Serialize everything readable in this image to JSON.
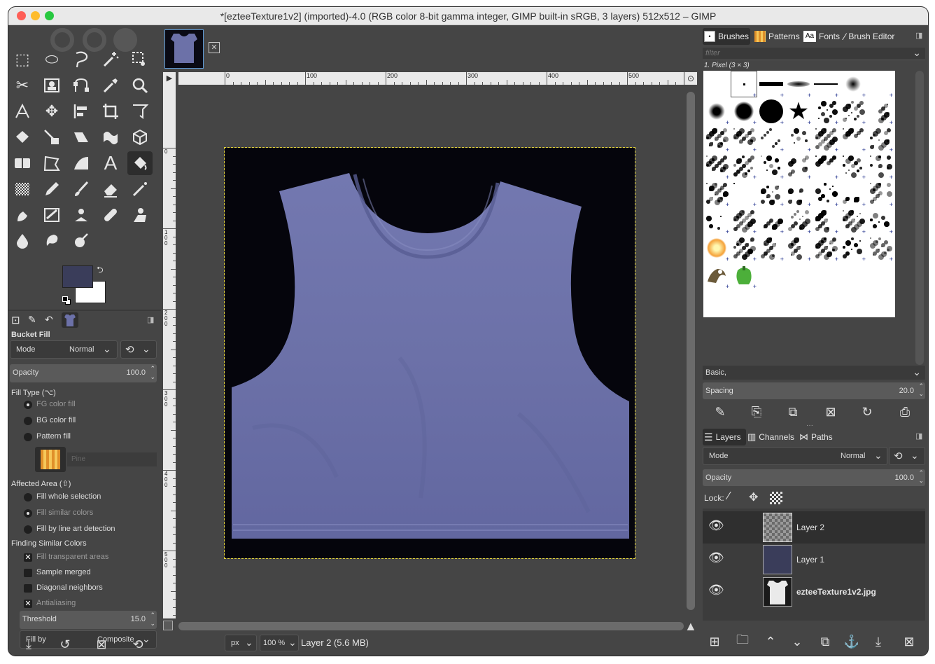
{
  "window": {
    "title": "*[ezteeTexture1v2] (imported)-4.0 (RGB color 8-bit gamma integer, GIMP built-in sRGB, 3 layers) 512x512 – GIMP",
    "traffic_lights": {
      "close": "#fe5f57",
      "minimize": "#febc2e",
      "zoom": "#28c840"
    }
  },
  "colors": {
    "fg_color": "#3a3d5a",
    "bg_color": "#ffffff",
    "accent": "#5f9bd8",
    "shirt": "#6c71a8",
    "canvas_bg": "#05050c"
  },
  "tool_options": {
    "title": "Bucket Fill",
    "mode_label": "Mode",
    "mode_value": "Normal",
    "opacity_label": "Opacity",
    "opacity_value": "100.0",
    "fill_type_label": "Fill Type  (⌥)",
    "fill_types": [
      {
        "label": "FG color fill",
        "selected": true
      },
      {
        "label": "BG color fill",
        "selected": false
      },
      {
        "label": "Pattern fill",
        "selected": false
      }
    ],
    "pattern_name": "Pine",
    "affected_area_label": "Affected Area  (⇧)",
    "affected_areas": [
      {
        "label": "Fill whole selection",
        "selected": false
      },
      {
        "label": "Fill similar colors",
        "selected": true
      },
      {
        "label": "Fill by line art detection",
        "selected": false
      }
    ],
    "finding_label": "Finding Similar Colors",
    "finding_options": [
      {
        "label": "Fill transparent areas",
        "checked": true
      },
      {
        "label": "Sample merged",
        "checked": false
      },
      {
        "label": "Diagonal neighbors",
        "checked": false
      },
      {
        "label": "Antialiasing",
        "checked": true
      }
    ],
    "threshold_label": "Threshold",
    "threshold_value": "15.0",
    "fill_by_label": "Fill by",
    "fill_by_value": "Composite"
  },
  "ruler": {
    "h_labels": [
      "0",
      "100",
      "200",
      "300",
      "400",
      "500"
    ],
    "v_labels": [
      "0",
      "100",
      "200",
      "300",
      "400",
      "500"
    ]
  },
  "status": {
    "unit": "px",
    "zoom": "100 %",
    "layer_info": "Layer 2 (5.6 MB)"
  },
  "brushes_panel": {
    "tabs": [
      "Brushes",
      "Patterns",
      "Fonts",
      "Brush Editor"
    ],
    "filter_placeholder": "filter",
    "selected_brush": "1. Pixel (3 × 3)",
    "tag_value": "Basic,",
    "spacing_label": "Spacing",
    "spacing_value": "20.0"
  },
  "layers_panel": {
    "tabs": [
      "Layers",
      "Channels",
      "Paths"
    ],
    "mode_label": "Mode",
    "mode_value": "Normal",
    "opacity_label": "Opacity",
    "opacity_value": "100.0",
    "lock_label": "Lock:",
    "layers": [
      {
        "name": "Layer 2",
        "bold": false,
        "selected": true
      },
      {
        "name": "Layer 1",
        "bold": false,
        "selected": false
      },
      {
        "name": "ezteeTexture1v2.jpg",
        "bold": true,
        "selected": false
      }
    ]
  }
}
